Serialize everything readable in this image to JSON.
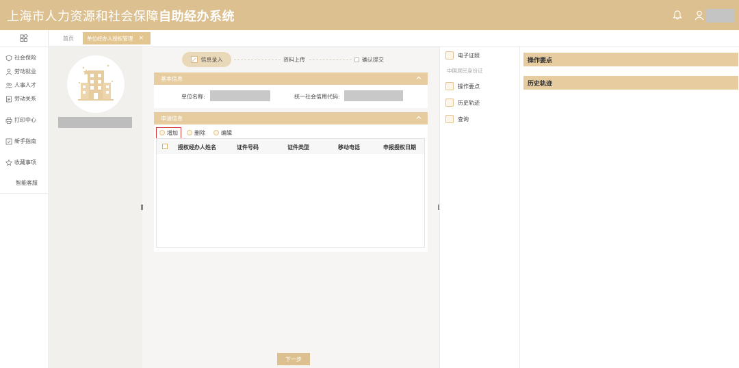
{
  "header": {
    "title_prefix": "上海市人力资源和社会保障",
    "title_bold": "自助经办系统",
    "bell_icon": "bell-icon",
    "user_icon": "user-icon"
  },
  "sidebar": {
    "items": [
      {
        "label": "社会保险",
        "icon": "shield-icon"
      },
      {
        "label": "劳动就业",
        "icon": "person-icon"
      },
      {
        "label": "人事人才",
        "icon": "people-icon"
      },
      {
        "label": "劳动关系",
        "icon": "document-icon"
      },
      {
        "label": "打印中心",
        "icon": "printer-icon"
      },
      {
        "label": "新手指南",
        "icon": "guide-icon"
      },
      {
        "label": "收藏事项",
        "icon": "star-icon"
      },
      {
        "label": "智能客服",
        "icon": ""
      }
    ]
  },
  "tabs": {
    "home": "首页",
    "active": "单位经办人授权管理",
    "close": "×"
  },
  "steps": {
    "step1": "信息录入",
    "step2": "资料上传",
    "step3": "确认提交"
  },
  "basic": {
    "title": "基本信息",
    "unit_name_label": "单位名称:",
    "credit_code_label": "统一社会信用代码:"
  },
  "apply": {
    "title": "申请信息",
    "add": "增加",
    "delete": "删除",
    "edit": "编辑",
    "columns": [
      "授权经办人姓名",
      "证件号码",
      "证件类型",
      "移动电话",
      "申报授权日期"
    ]
  },
  "next_button": "下一步",
  "right_menu": {
    "items": [
      "电子证照",
      "操作要点",
      "历史轨迹",
      "查询"
    ],
    "sub_text": "中国居民身份证"
  },
  "right_panel": {
    "ops_title": "操作要点",
    "history_title": "历史轨迹"
  },
  "colors": {
    "accent": "#dcc08f",
    "section": "#e6cc9e",
    "highlight": "#d43c3c"
  }
}
